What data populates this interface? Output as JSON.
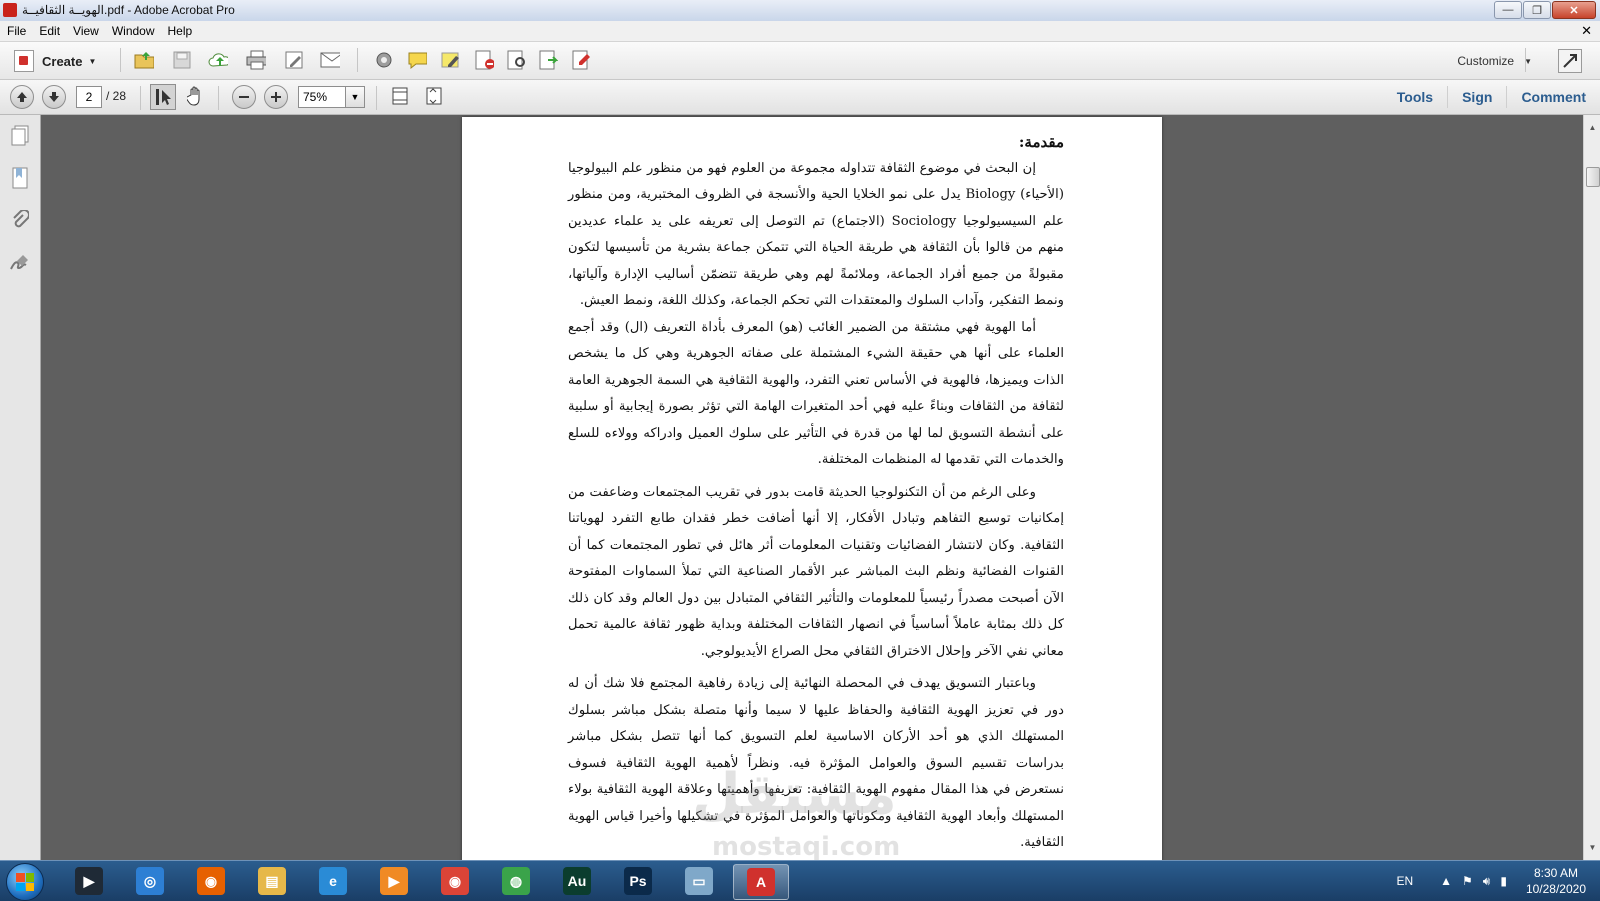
{
  "window": {
    "title": "الهويــة الثقافيــة.pdf - Adobe Acrobat Pro",
    "min_glyph": "—",
    "max_glyph": "❐",
    "close_glyph": "✕"
  },
  "menu": {
    "items": [
      "File",
      "Edit",
      "View",
      "Window",
      "Help"
    ],
    "doc_close": "✕"
  },
  "toolbar": {
    "create_label": "Create",
    "create_caret": "▼",
    "customize_label": "Customize",
    "customize_caret": "▼",
    "icons": [
      "open-folder-icon",
      "save-icon",
      "upload-cloud-icon",
      "print-icon",
      "edit-icon",
      "email-icon",
      "settings-icon",
      "comment-icon",
      "highlight-icon",
      "delete-page-icon",
      "review-icon",
      "export-icon",
      "stamp-icon"
    ]
  },
  "nav": {
    "current_page": "2",
    "page_total": "/ 28",
    "zoom": "75%",
    "zoom_caret": "▼"
  },
  "right_links": [
    "Tools",
    "Sign",
    "Comment"
  ],
  "document": {
    "heading": "مقدمة:",
    "paragraphs": [
      "إن البحث في موضوع الثقافة تتداوله مجموعة من العلوم فهو من منظور علم البيولوجيا (الأحياء) Biology يدل على نمو الخلايا الحية والأنسجة في الظروف المختبرية، ومن منظور علم السيسيولوجيا Sociology (الاجتماع) تم التوصل إلى تعريفه على يد علماء عديدين منهم من قالوا بأن الثقافة هي طريقة الحياة التي تتمكن جماعة بشرية من تأسيسها لتكون مقبولةً من جميع أفراد الجماعة، وملائمةً لهم وهي طريقة تتضمّن أساليب الإدارة وآلياتها، ونمط التفكير، وآداب السلوك والمعتقدات التي تحكم الجماعة، وكذلك اللغة، ونمط العيش.",
      "أما الهوية فهي مشتقة من الضمير الغائب (هو) المعرف بأداة التعريف (ال) وقد أجمع العلماء على أنها هي حقيقة الشيء المشتملة على صفاته الجوهرية وهي كل ما يشخص الذات ويميزها، فالهوية في الأساس تعني التفرد، والهوية الثقافية هي السمة الجوهرية العامة لثقافة من الثقافات وبناءً عليه فهي أحد المتغيرات الهامة التي تؤثر بصورة إيجابية أو سلبية على أنشطة التسويق لما لها من قدرة في التأثير على سلوك العميل وادراكه وولاءه للسلع والخدمات التي تقدمها له المنظمات المختلفة.",
      "وعلى الرغم من أن التكنولوجيا الحديثة قامت بدور في تقريب المجتمعات وضاعفت من إمكانيات توسيع التفاهم وتبادل الأفكار، إلا أنها أضافت خطر فقدان طابع التفرد لهوياتنا الثقافية. وكان لانتشار الفضائيات وتقنيات المعلومات أثر هائل في تطور المجتمعات كما أن القنوات الفضائية ونظم البث المباشر عبر الأقمار الصناعية التي تملأ السماوات المفتوحة الآن أصبحت مصدراً رئيسياً للمعلومات والتأثير الثقافي المتبادل بين دول العالم وقد كان ذلك كل ذلك بمثابة عاملاً أساسياً في انصهار الثقافات المختلفة وبداية ظهور ثقافة عالمية تحمل معاني نفي الآخر وإحلال الاختراق الثقافي محل الصراع الأيديولوجي.",
      "وباعتبار التسويق يهدف في المحصلة النهائية إلى زيادة رفاهية المجتمع فلا شك أن له دور في تعزيز الهوية الثقافية والحفاظ عليها لا سيما وأنها متصلة بشكل مباشر بسلوك المستهلك الذي هو أحد الأركان الاساسية لعلم التسويق كما أنها تتصل بشكل مباشر بدراسات تقسيم السوق والعوامل المؤثرة فيه. ونظراً لأهمية الهوية الثقافية فسوف نستعرض في هذا المقال مفهوم الهوية الثقافية: تعريفها وأهميتها وعلاقة الهوية الثقافية بولاء المستهلك وأبعاد الهوية الثقافية ومكوناتها والعوامل المؤثرة في تشكيلها وأخيرا قياس الهوية الثقافية."
    ],
    "watermark": "مستقل",
    "watermark_sub": "mostaqi.com"
  },
  "taskbar": {
    "apps": [
      {
        "name": "media-player",
        "glyph": "▶",
        "color": "#1f2a36"
      },
      {
        "name": "app-swirl",
        "glyph": "◎",
        "color": "#2d7fd4"
      },
      {
        "name": "firefox",
        "glyph": "◉",
        "color": "#e66000"
      },
      {
        "name": "file-explorer",
        "glyph": "▤",
        "color": "#e6b84a"
      },
      {
        "name": "internet-explorer",
        "glyph": "e",
        "color": "#2a8bd6"
      },
      {
        "name": "media-center",
        "glyph": "▶",
        "color": "#f08a24"
      },
      {
        "name": "chrome",
        "glyph": "◉",
        "color": "#db4437"
      },
      {
        "name": "green-app",
        "glyph": "◍",
        "color": "#3aa34a"
      },
      {
        "name": "audition",
        "glyph": "Au",
        "color": "#0b3d2e"
      },
      {
        "name": "photoshop",
        "glyph": "Ps",
        "color": "#0b2a4a"
      },
      {
        "name": "notepad",
        "glyph": "▭",
        "color": "#7fa8c9"
      },
      {
        "name": "acrobat",
        "glyph": "A",
        "color": "#d0312d"
      }
    ],
    "lang": "EN",
    "time": "8:30 AM",
    "date": "10/28/2020"
  }
}
